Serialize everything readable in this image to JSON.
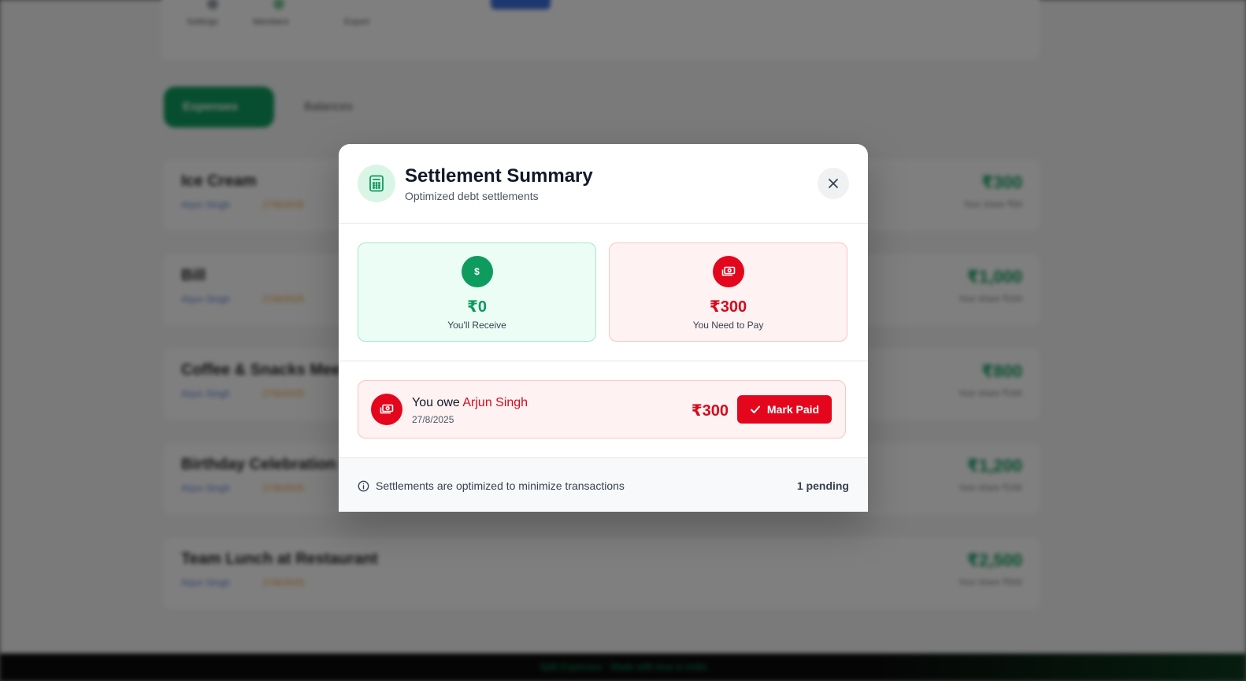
{
  "background": {
    "nav_labels": [
      "Settings",
      "Members",
      "Export"
    ],
    "tabs": [
      "Expenses",
      "Balances"
    ],
    "expenses": [
      {
        "title": "Ice Cream",
        "paid_by": "Arjun Singh",
        "date": "27/8/2025",
        "amount": "₹300",
        "sub": "Your share ₹60"
      },
      {
        "title": "Bill",
        "paid_by": "Arjun Singh",
        "date": "27/8/2025",
        "amount": "₹1,000",
        "sub": "Your share ₹200"
      },
      {
        "title": "Coffee & Snacks Meetup",
        "paid_by": "Arjun Singh",
        "date": "27/8/2025",
        "amount": "₹800",
        "sub": "Your share ₹160"
      },
      {
        "title": "Birthday Celebration Dinner",
        "paid_by": "Arjun Singh",
        "date": "27/8/2025",
        "amount": "₹1,200",
        "sub": "Your share ₹240"
      },
      {
        "title": "Team Lunch at Restaurant",
        "paid_by": "Arjun Singh",
        "date": "27/8/2025",
        "amount": "₹2,500",
        "sub": "Your share ₹500"
      }
    ],
    "footer": "Split Expenses · Made with love in India"
  },
  "modal": {
    "title": "Settlement Summary",
    "subtitle": "Optimized debt settlements",
    "icons": {
      "header": "calculator-icon",
      "close": "close-icon",
      "receive": "dollar-icon",
      "pay": "cash-icon",
      "check": "check-icon",
      "info": "info-icon"
    },
    "receive": {
      "amount": "₹0",
      "label": "You'll Receive",
      "icon_text": "$"
    },
    "pay": {
      "amount": "₹300",
      "label": "You Need to Pay"
    },
    "settlement": {
      "prefix": "You owe",
      "name": "Arjun Singh",
      "date": "27/8/2025",
      "amount": "₹300",
      "button": "Mark Paid"
    },
    "footer": {
      "info": "Settlements are optimized to minimize transactions",
      "pending": "1 pending"
    },
    "colors": {
      "green": "#0e9b5e",
      "red": "#e3061c",
      "green_bg": "#ecfdf5",
      "red_bg": "#fef2f2"
    }
  }
}
